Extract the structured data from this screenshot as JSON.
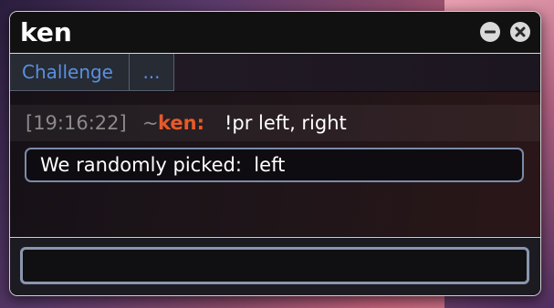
{
  "window": {
    "title": "ken",
    "controls": {
      "minimize_icon": "minus-circle-icon",
      "close_icon": "x-circle-icon"
    }
  },
  "tabs": [
    {
      "label": "Challenge"
    },
    {
      "label": "..."
    }
  ],
  "messages": [
    {
      "timestamp": "[19:16:22]",
      "rank_symbol": "~",
      "user": "ken:",
      "text": "!pr left, right"
    }
  ],
  "system_message": "We randomly picked:  left",
  "input": {
    "value": "",
    "placeholder": ""
  },
  "colors": {
    "username": "#e55a2a",
    "tab_text": "#5b8fe0",
    "timestamp": "#8a8a8a",
    "window_bg": "#0d0b10",
    "border": "#7a8ba8"
  }
}
